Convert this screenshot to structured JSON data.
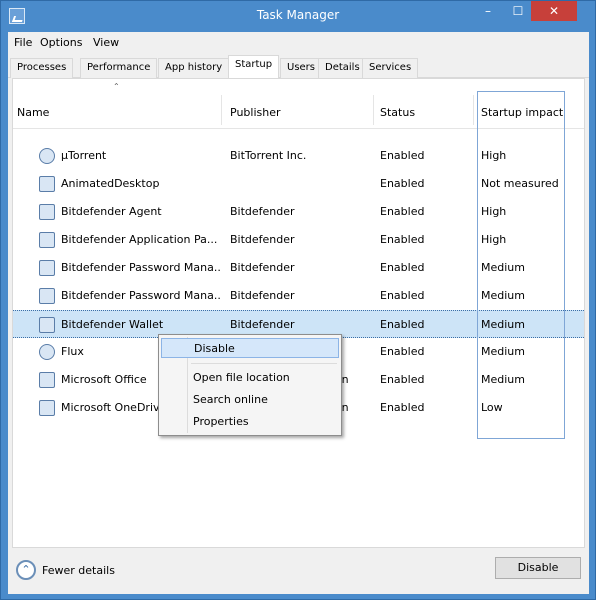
{
  "window": {
    "title": "Task Manager",
    "min_glyph": "–",
    "max_glyph": "☐",
    "close_glyph": "✕"
  },
  "menu": [
    "File",
    "Options",
    "View"
  ],
  "tabs": [
    "Processes",
    "Performance",
    "App history",
    "Startup",
    "Users",
    "Details",
    "Services"
  ],
  "active_tab": "Startup",
  "columns": {
    "name": "Name",
    "publisher": "Publisher",
    "status": "Status",
    "impact": "Startup impact"
  },
  "rows": [
    {
      "name": "µTorrent",
      "publisher": "BitTorrent Inc.",
      "status": "Enabled",
      "impact": "High",
      "icon": "utorrent-icon"
    },
    {
      "name": "AnimatedDesktop",
      "publisher": "",
      "status": "Enabled",
      "impact": "Not measured",
      "icon": "app-window-icon"
    },
    {
      "name": "Bitdefender Agent",
      "publisher": "Bitdefender",
      "status": "Enabled",
      "impact": "High",
      "icon": "bitdefender-icon"
    },
    {
      "name": "Bitdefender Application Pa...",
      "publisher": "Bitdefender",
      "status": "Enabled",
      "impact": "High",
      "icon": "bitdefender-icon"
    },
    {
      "name": "Bitdefender Password Mana...",
      "publisher": "Bitdefender",
      "status": "Enabled",
      "impact": "Medium",
      "icon": "bitdefender-icon"
    },
    {
      "name": "Bitdefender Password Mana...",
      "publisher": "Bitdefender",
      "status": "Enabled",
      "impact": "Medium",
      "icon": "app-window-icon"
    },
    {
      "name": "Bitdefender Wallet",
      "publisher": "Bitdefender",
      "status": "Enabled",
      "impact": "Medium",
      "icon": "bitdefender-icon",
      "selected": true
    },
    {
      "name": "Flux",
      "publisher": "",
      "status": "Enabled",
      "impact": "Medium",
      "icon": "flux-icon"
    },
    {
      "name": "Microsoft Office",
      "publisher": "Microsoft Corporation",
      "status": "Enabled",
      "impact": "Medium",
      "icon": "office-icon"
    },
    {
      "name": "Microsoft OneDrive",
      "publisher": "Microsoft Corporation",
      "status": "Enabled",
      "impact": "Low",
      "icon": "onedrive-icon"
    }
  ],
  "context_menu": {
    "disable": "Disable",
    "open_location": "Open file location",
    "search_online": "Search online",
    "properties": "Properties"
  },
  "footer": {
    "fewer_details": "Fewer details",
    "disable_button": "Disable"
  }
}
